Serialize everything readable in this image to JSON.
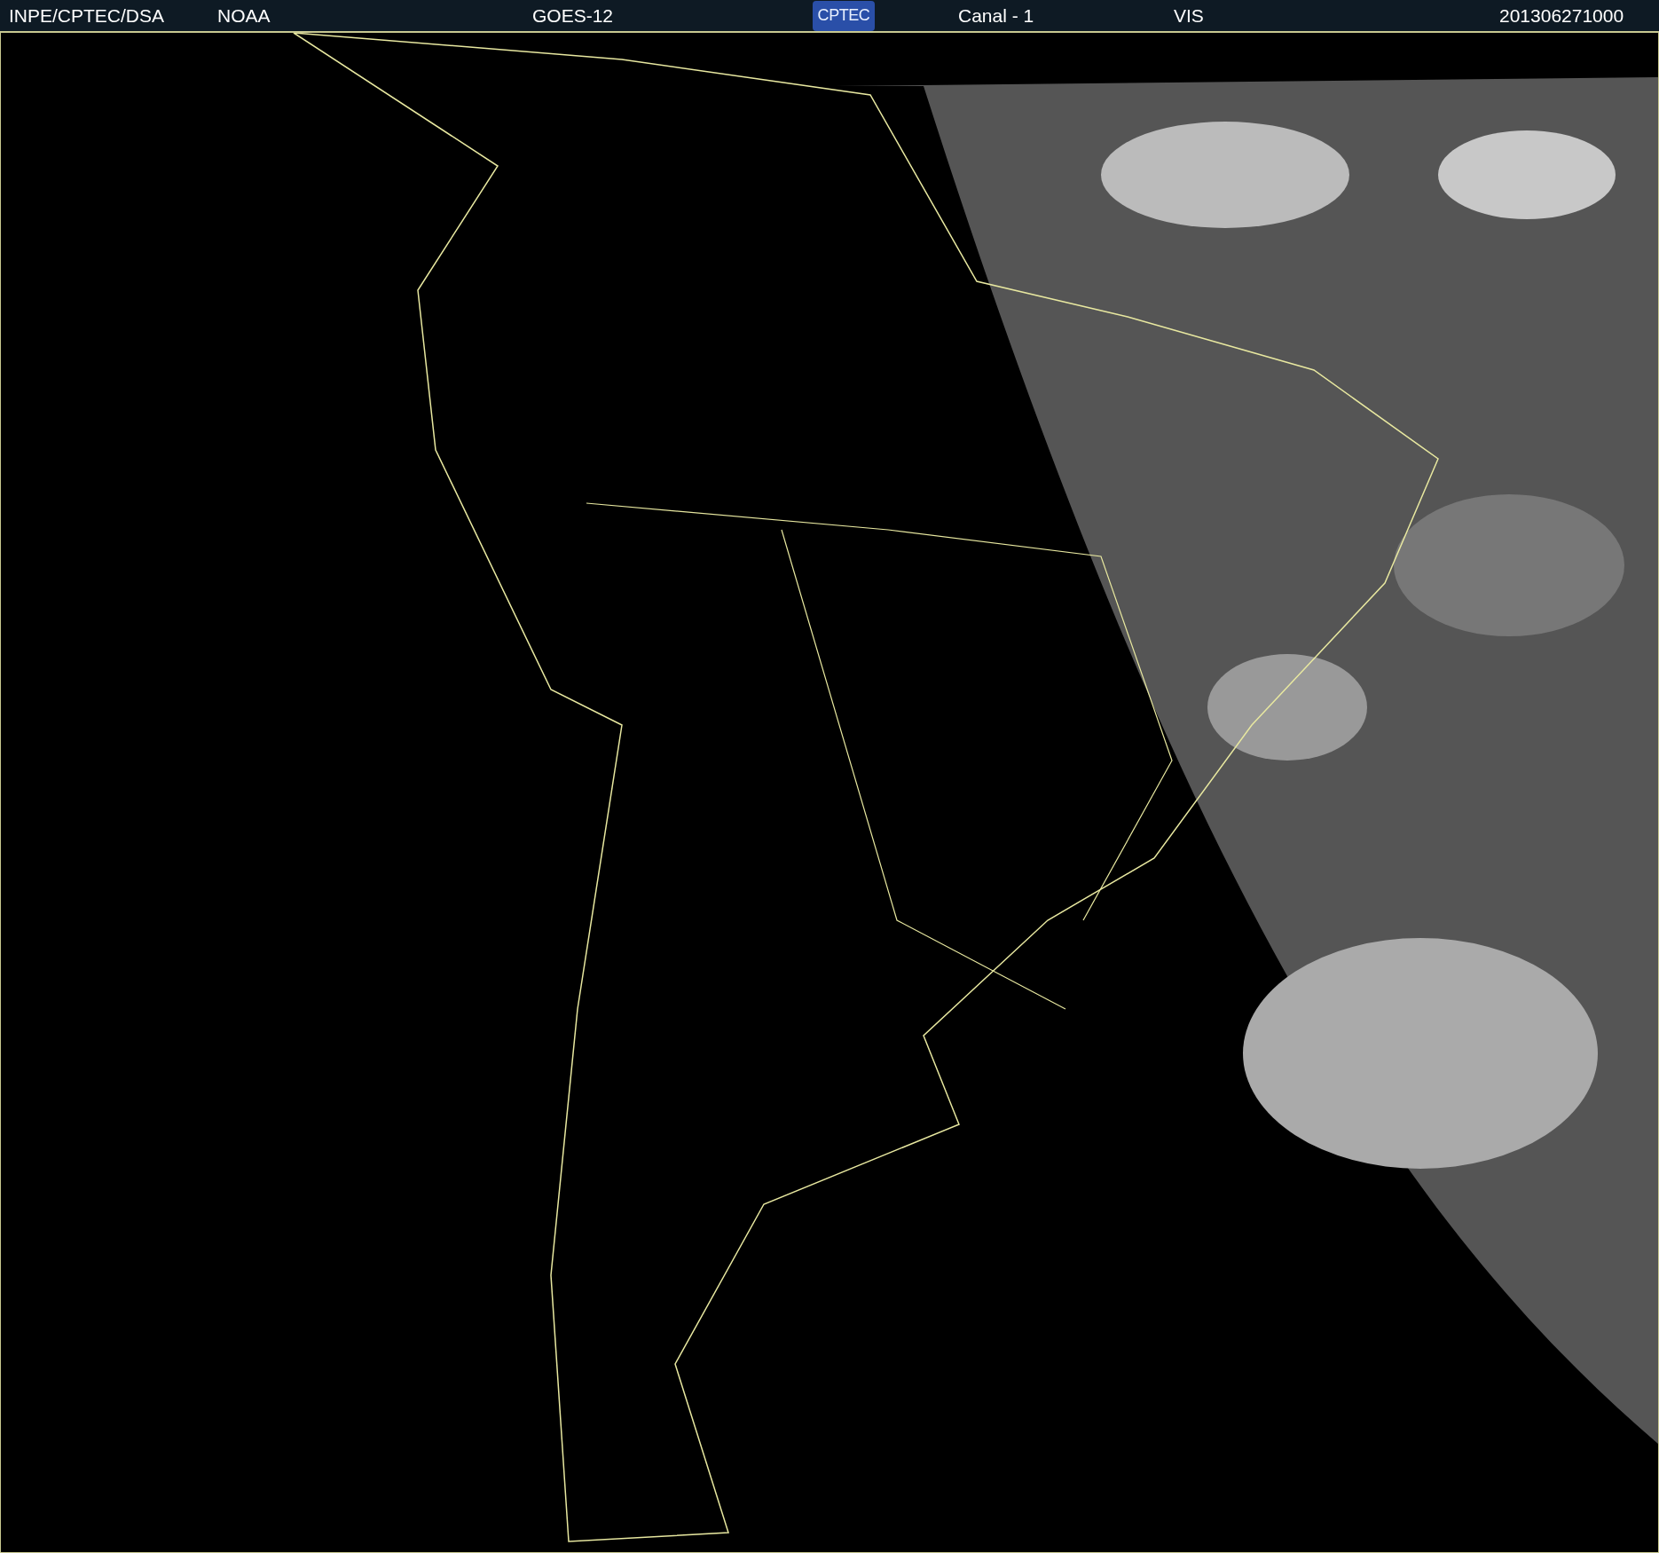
{
  "header": {
    "source": "INPE/CPTEC/DSA",
    "agency": "NOAA",
    "satellite": "GOES-12",
    "logo": "CPTEC",
    "channel": "Canal - 1",
    "band": "VIS",
    "timestamp": "201306271000"
  }
}
